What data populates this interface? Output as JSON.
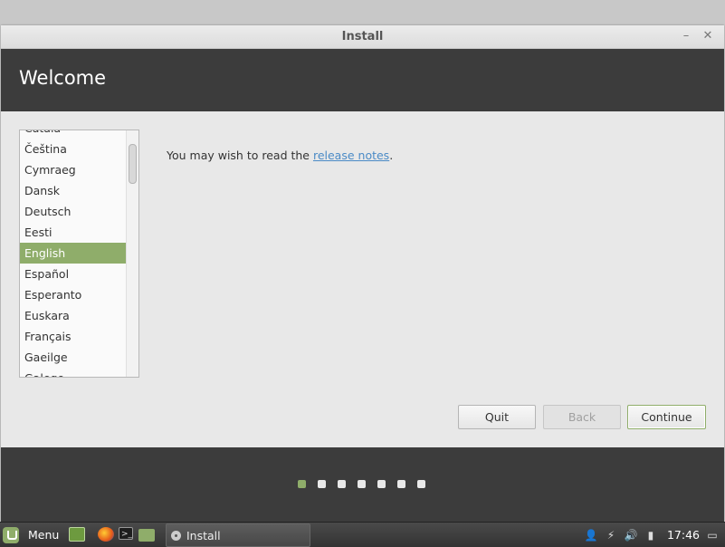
{
  "window": {
    "title": "Install",
    "minimize_glyph": "–",
    "close_glyph": "✕"
  },
  "header": {
    "title": "Welcome"
  },
  "languages": {
    "items": [
      "Català",
      "Čeština",
      "Cymraeg",
      "Dansk",
      "Deutsch",
      "Eesti",
      "English",
      "Español",
      "Esperanto",
      "Euskara",
      "Français",
      "Gaeilge",
      "Galego"
    ],
    "selected": "English"
  },
  "release": {
    "prefix": "You may wish to read the ",
    "link": "release notes",
    "suffix": "."
  },
  "buttons": {
    "quit": "Quit",
    "back": "Back",
    "continue": "Continue"
  },
  "progress": {
    "total_steps": 7,
    "current_step": 1
  },
  "taskbar": {
    "menu_label": "Menu",
    "task_label": "Install",
    "terminal_glyph": ">_",
    "clock": "17:46",
    "tray_icons": [
      "user-icon",
      "network-icon",
      "volume-icon",
      "battery-icon",
      "desktop-icon"
    ]
  },
  "colors": {
    "accent": "#8fad6a",
    "header_bg": "#3c3c3c",
    "link": "#4a8ac6"
  }
}
